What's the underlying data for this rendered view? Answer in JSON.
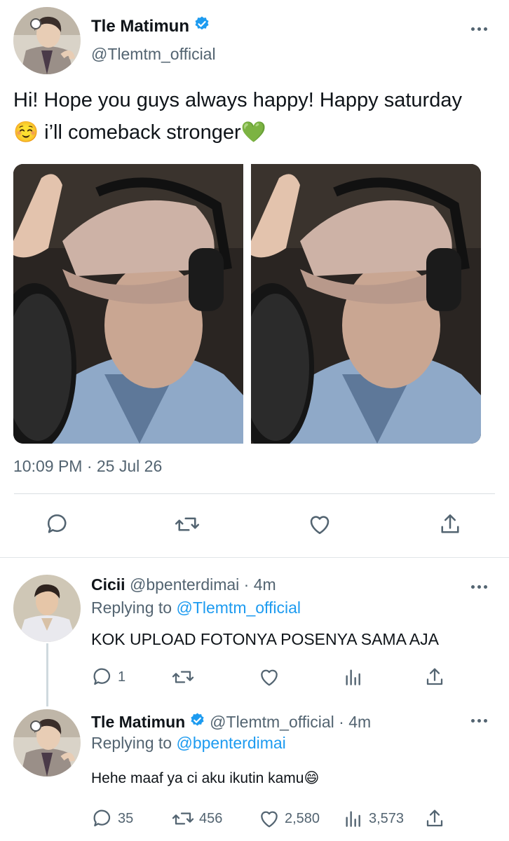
{
  "main_tweet": {
    "author_name": "Tle Matimun",
    "handle": "@Tlemtm_official",
    "text": "Hi! Hope you guys always happy! Happy saturday☺️  i’ll comeback stronger💚",
    "timestamp": "10:09 PM · 25 Jul 26",
    "photo_count": 2
  },
  "reply_1": {
    "author_name": "Cicii",
    "meta": "@bpenterdimai · 4m",
    "replying_prefix": "Replying to",
    "replying_to": "@Tlemtm_official",
    "text": "KOK UPLOAD FOTONYA POSENYA SAMA AJA",
    "reply_count": "1"
  },
  "reply_2": {
    "author_name": "Tle Matimun",
    "meta": "@Tlemtm_official · 4m",
    "replying_prefix": "Replying to",
    "replying_to": "@bpenterdimai",
    "text": "Hehe maaf ya ci aku ikutin kamu😄",
    "reply_count": "35",
    "retweet_count": "456",
    "like_count": "2,580",
    "view_count": "3,573"
  },
  "colors": {
    "accent": "#1d9bf0",
    "muted": "#536471",
    "text": "#0f1419"
  },
  "icons": [
    "verified-badge-icon",
    "more-icon",
    "reply-icon",
    "retweet-icon",
    "like-icon",
    "share-icon",
    "views-icon"
  ]
}
